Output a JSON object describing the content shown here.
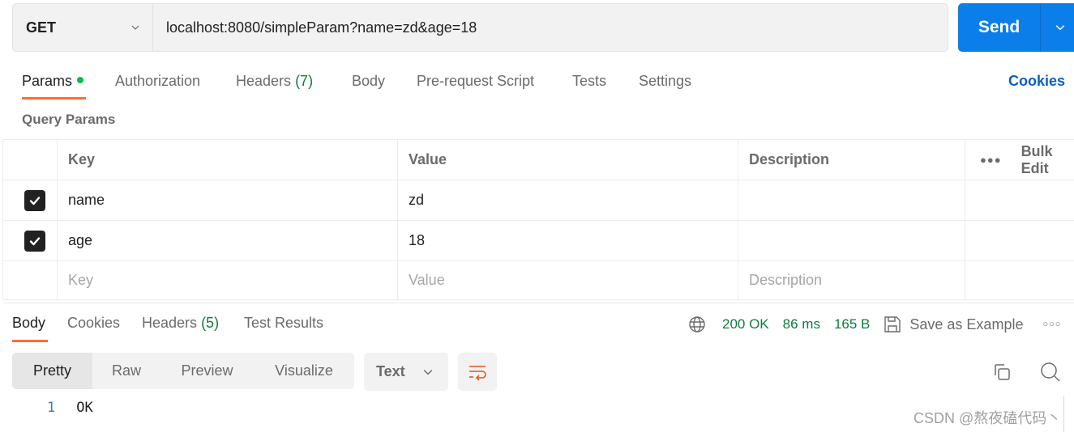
{
  "request": {
    "method": "GET",
    "url": "localhost:8080/simpleParam?name=zd&age=18",
    "send_label": "Send"
  },
  "request_tabs": [
    {
      "label": "Params",
      "active": true,
      "indicator": "green-dot"
    },
    {
      "label": "Authorization"
    },
    {
      "label": "Headers",
      "count": "(7)"
    },
    {
      "label": "Body"
    },
    {
      "label": "Pre-request Script"
    },
    {
      "label": "Tests"
    },
    {
      "label": "Settings"
    }
  ],
  "cookies_link": "Cookies",
  "query_params": {
    "title": "Query Params",
    "columns": {
      "key": "Key",
      "value": "Value",
      "description": "Description"
    },
    "bulk_edit": "Bulk Edit",
    "rows": [
      {
        "checked": true,
        "key": "name",
        "value": "zd",
        "description": ""
      },
      {
        "checked": true,
        "key": "age",
        "value": "18",
        "description": ""
      }
    ],
    "placeholders": {
      "key": "Key",
      "value": "Value",
      "description": "Description"
    }
  },
  "response": {
    "tabs": [
      {
        "label": "Body",
        "active": true
      },
      {
        "label": "Cookies"
      },
      {
        "label": "Headers",
        "count": "(5)"
      },
      {
        "label": "Test Results"
      }
    ],
    "status": "200 OK",
    "time": "86 ms",
    "size": "165 B",
    "save_example": "Save as Example",
    "views": [
      "Pretty",
      "Raw",
      "Preview",
      "Visualize"
    ],
    "active_view": "Pretty",
    "format": "Text",
    "body_lines": [
      {
        "number": "1",
        "text": "OK"
      }
    ]
  },
  "watermark": "CSDN @熬夜磕代码丶",
  "colors": {
    "accent_orange": "#ff6c37",
    "send_blue": "#0c7ee9",
    "status_green": "#0f7b3d",
    "link_blue": "#0b5ec9"
  }
}
